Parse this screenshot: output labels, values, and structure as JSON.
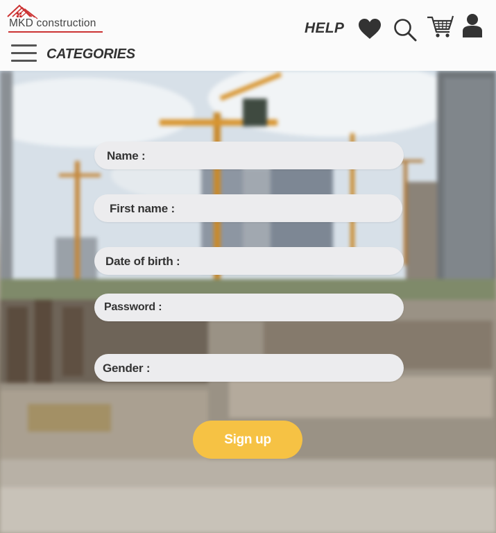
{
  "header": {
    "logo_text": "MKD construction",
    "help_label": "HELP",
    "categories_label": "CATEGORIES",
    "icons": [
      "heart-icon",
      "search-icon",
      "cart-icon",
      "user-icon",
      "menu-icon"
    ]
  },
  "form": {
    "name_label": "Name :",
    "first_name_label": "First name :",
    "dob_label": "Date of birth :",
    "password_label": "Password :",
    "gender_label": "Gender :",
    "submit_label": "Sign up"
  },
  "colors": {
    "accent": "#f6c244",
    "logo_red": "#c33",
    "field_bg": "#ececee"
  }
}
